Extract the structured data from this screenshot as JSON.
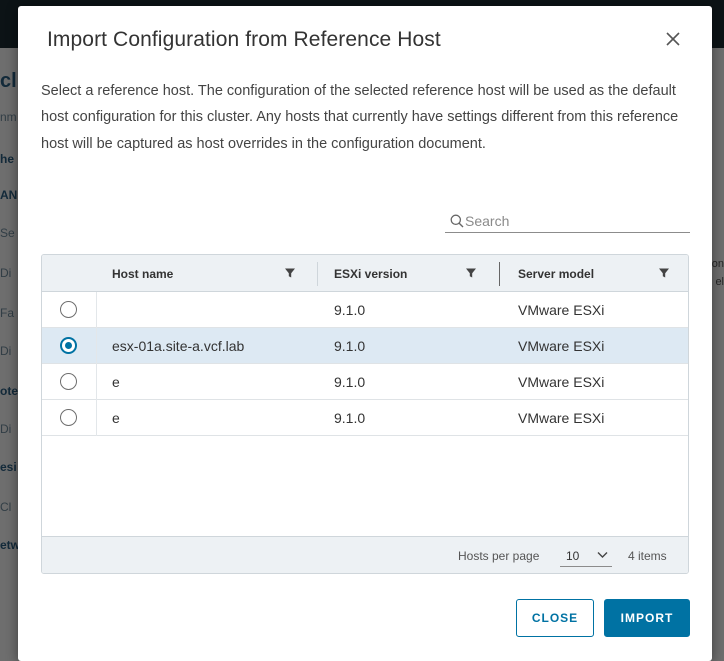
{
  "background": {
    "left_fragments": [
      "cl",
      "nm",
      "he",
      "AN",
      "Se",
      "Di",
      "Fa",
      "Di",
      "ote",
      "Di",
      "esi",
      "Cl",
      "etw"
    ],
    "right_fragments": [
      "on",
      "el"
    ]
  },
  "dialog": {
    "title": "Import Configuration from Reference Host",
    "close_icon": "close-icon",
    "description": "Select a reference host. The configuration of the selected reference host will be used as the default host configuration for this cluster. Any hosts that currently have settings different from this reference host will be captured as host overrides in the configuration document.",
    "search": {
      "placeholder": "Search",
      "value": "",
      "icon": "search-icon"
    },
    "table": {
      "columns": [
        {
          "label": "Host name",
          "filter_icon": "filter-icon"
        },
        {
          "label": "ESXi version",
          "filter_icon": "filter-icon"
        },
        {
          "label": "Server model",
          "filter_icon": "filter-icon"
        }
      ],
      "rows": [
        {
          "selected": false,
          "host_name": "",
          "esxi_version": "9.1.0",
          "server_model": "VMware ESXi"
        },
        {
          "selected": true,
          "host_name": "esx-01a.site-a.vcf.lab",
          "esxi_version": "9.1.0",
          "server_model": "VMware ESXi"
        },
        {
          "selected": false,
          "host_name": "e",
          "esxi_version": "9.1.0",
          "server_model": "VMware ESXi"
        },
        {
          "selected": false,
          "host_name": "e",
          "esxi_version": "9.1.0",
          "server_model": "VMware ESXi"
        }
      ],
      "footer": {
        "hosts_per_page_label": "Hosts per page",
        "hosts_per_page_value": "10",
        "item_count": "4 items"
      }
    },
    "buttons": {
      "close": "CLOSE",
      "import": "IMPORT"
    },
    "colors": {
      "accent": "#0072a3",
      "selected_row": "#dde9f3",
      "header_bg": "#edf1f4"
    }
  }
}
